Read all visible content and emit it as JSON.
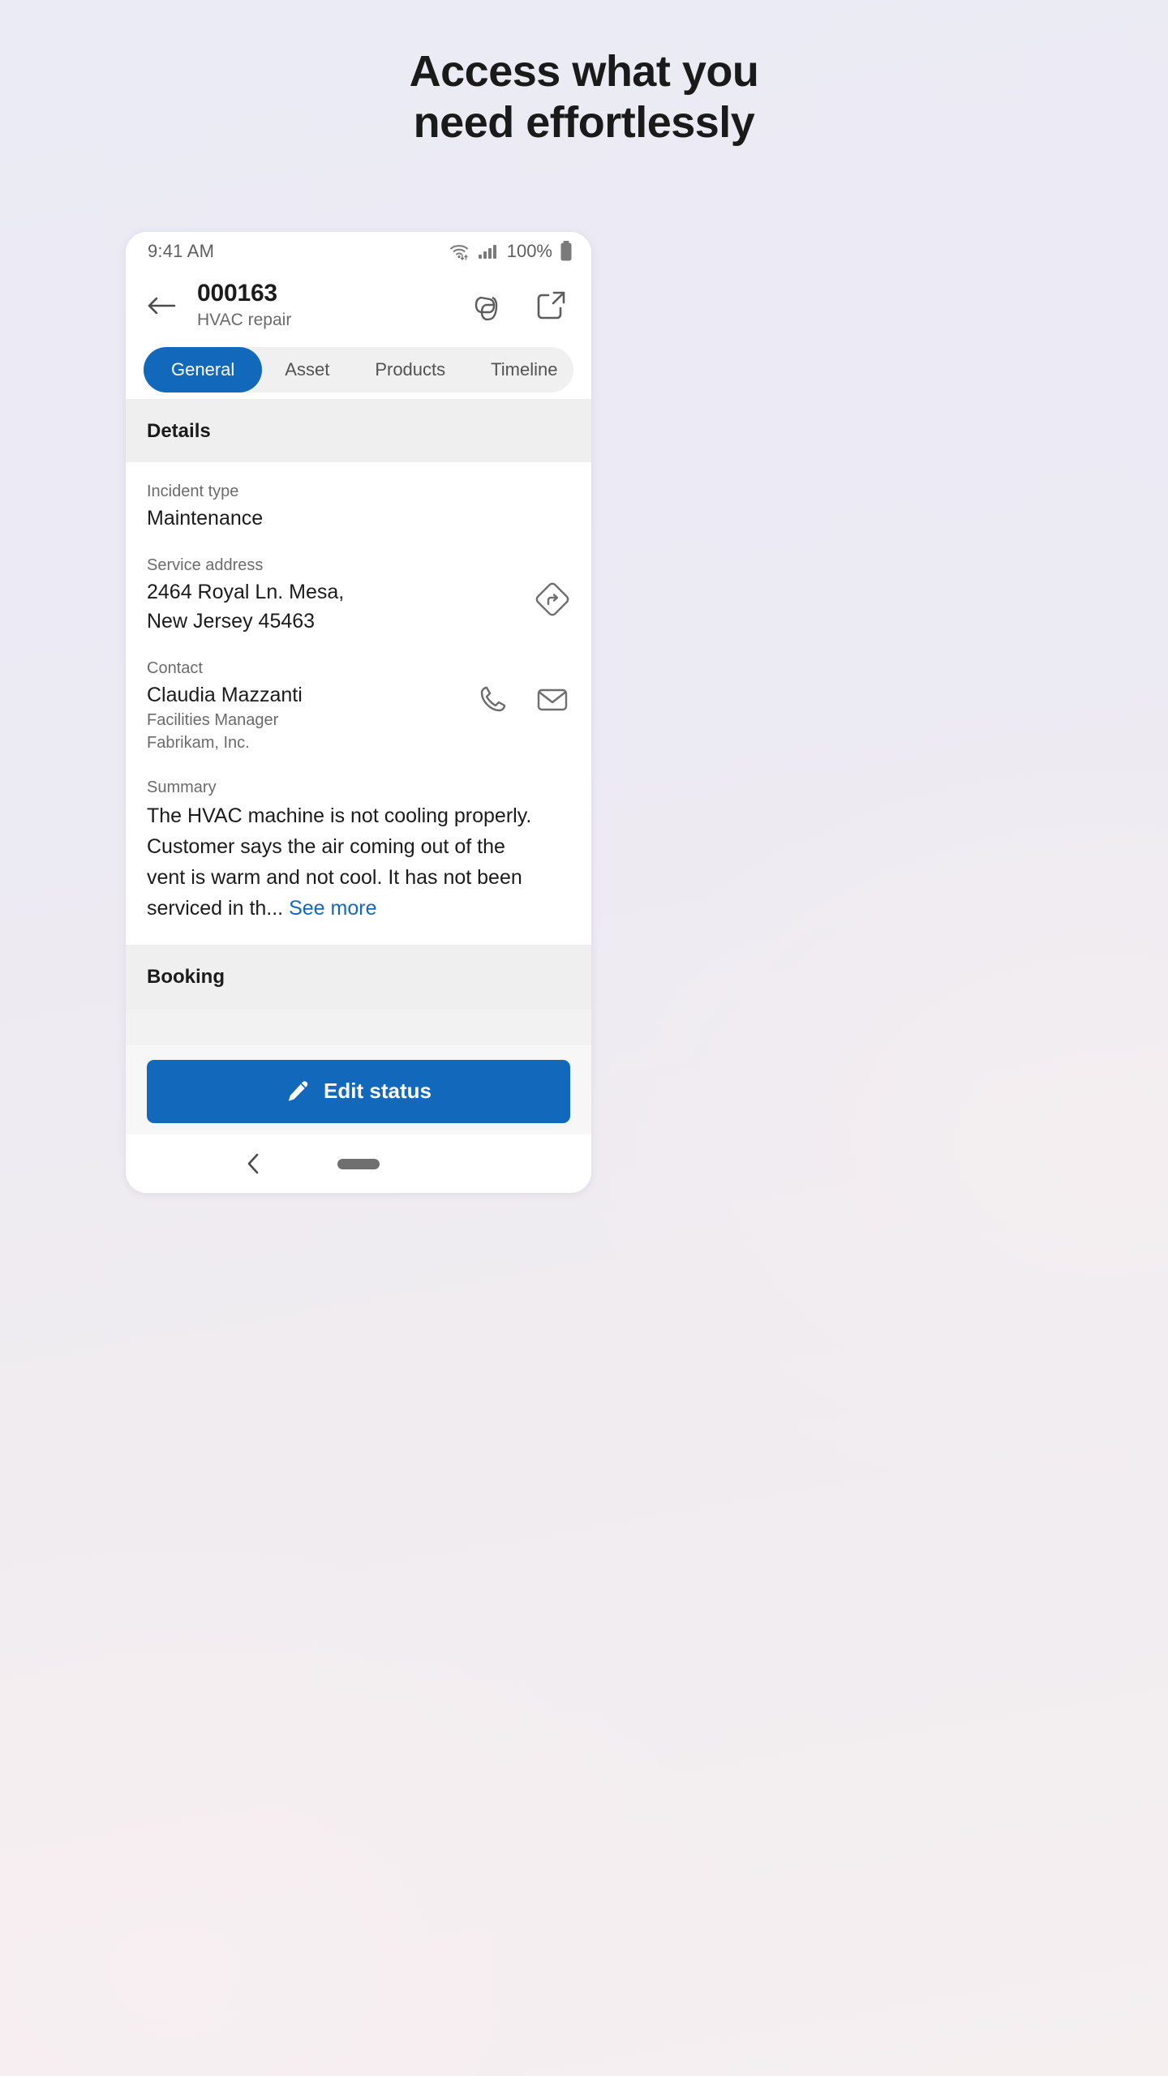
{
  "headline": {
    "line1": "Access what you",
    "line2": "need effortlessly"
  },
  "phone": {
    "status_bar": {
      "time": "9:41 AM",
      "battery_percent": "100%",
      "wifi_icon": "wifi-icon",
      "signal_icon": "cellular-signal-icon",
      "battery_icon": "battery-icon"
    },
    "app_bar": {
      "back_icon": "arrow-left-icon",
      "title": "000163",
      "subtitle": "HVAC repair",
      "copilot_icon": "copilot-icon",
      "open_in_new_icon": "open-in-new-icon"
    },
    "tabs": [
      {
        "label": "General",
        "active": true
      },
      {
        "label": "Asset",
        "active": false
      },
      {
        "label": "Products",
        "active": false
      },
      {
        "label": "Timeline",
        "active": false
      }
    ],
    "details": {
      "section_title": "Details",
      "incident_type": {
        "label": "Incident type",
        "value": "Maintenance"
      },
      "service_address": {
        "label": "Service address",
        "line1": "2464 Royal Ln. Mesa,",
        "line2": "New Jersey 45463",
        "directions_icon": "directions-icon"
      },
      "contact": {
        "label": "Contact",
        "name": "Claudia Mazzanti",
        "role": "Facilities Manager",
        "company": "Fabrikam, Inc.",
        "phone_icon": "phone-icon",
        "mail_icon": "mail-icon"
      },
      "summary": {
        "label": "Summary",
        "line1": "The HVAC machine is not cooling properly.",
        "line2": "Customer says the air coming out of the",
        "line3": "vent is warm and not cool. It has not been",
        "line4": "serviced in th...",
        "see_more": "See more"
      }
    },
    "booking": {
      "section_title": "Booking"
    },
    "action_bar": {
      "edit_status_label": "Edit status",
      "edit_icon": "pencil-icon"
    },
    "nav_bar": {
      "back_icon": "chevron-left-icon",
      "home_pill": "home-indicator"
    }
  },
  "colors": {
    "accent": "#1268bb",
    "link": "#1268bb",
    "section_bg": "#efefef",
    "text_primary": "#1b1b1b",
    "text_secondary": "#6b6b6b"
  }
}
